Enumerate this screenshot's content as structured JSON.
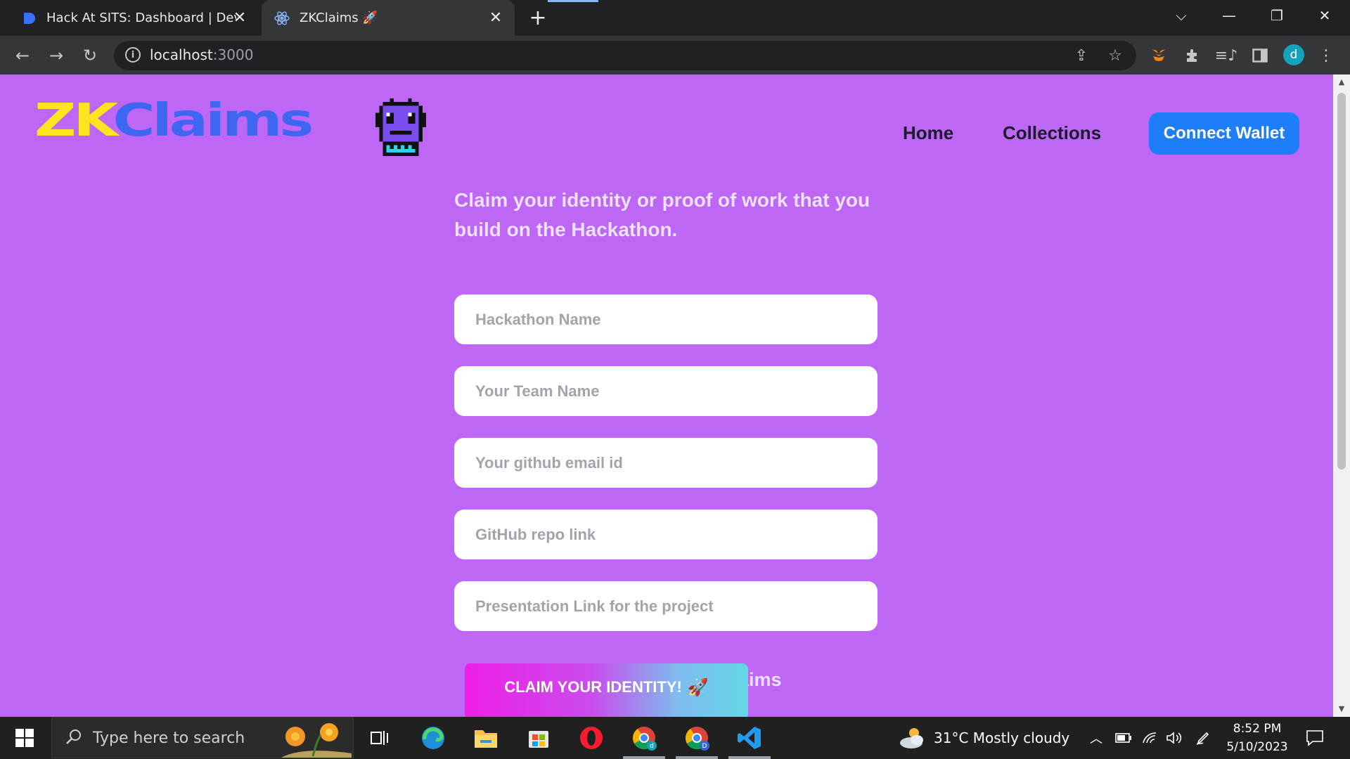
{
  "browser": {
    "tabs": [
      {
        "title": "Hack At SITS: Dashboard | Devfolio",
        "icon": "devfolio-icon"
      },
      {
        "title": "ZKClaims 🚀",
        "icon": "react-icon"
      }
    ],
    "url_host": "localhost",
    "url_port": ":3000",
    "profile_initial": "d"
  },
  "header": {
    "logo_zk": "ZK",
    "logo_claims": "Claims",
    "nav": {
      "home": "Home",
      "collections": "Collections"
    },
    "connect_wallet": "Connect Wallet"
  },
  "main": {
    "intro": "Claim your identity or proof of work that you build on the Hackathon.",
    "fields": {
      "hackathon_name": "Hackathon Name",
      "team_name": "Your Team Name",
      "github_email": "Your github email id",
      "github_repo": "GitHub repo link",
      "presentation_link": "Presentation Link for the project"
    },
    "claim_button": "CLAIM YOUR IDENTITY!",
    "collections_partial": "aims"
  },
  "colors": {
    "page_bg": "#be66f5",
    "logo_yellow": "#fce41e",
    "logo_blue": "#3e67f1",
    "wallet_button": "#1e7df8"
  },
  "taskbar": {
    "search_placeholder": "Type here to search",
    "weather": "31°C  Mostly cloudy",
    "time": "8:52 PM",
    "date": "5/10/2023"
  }
}
